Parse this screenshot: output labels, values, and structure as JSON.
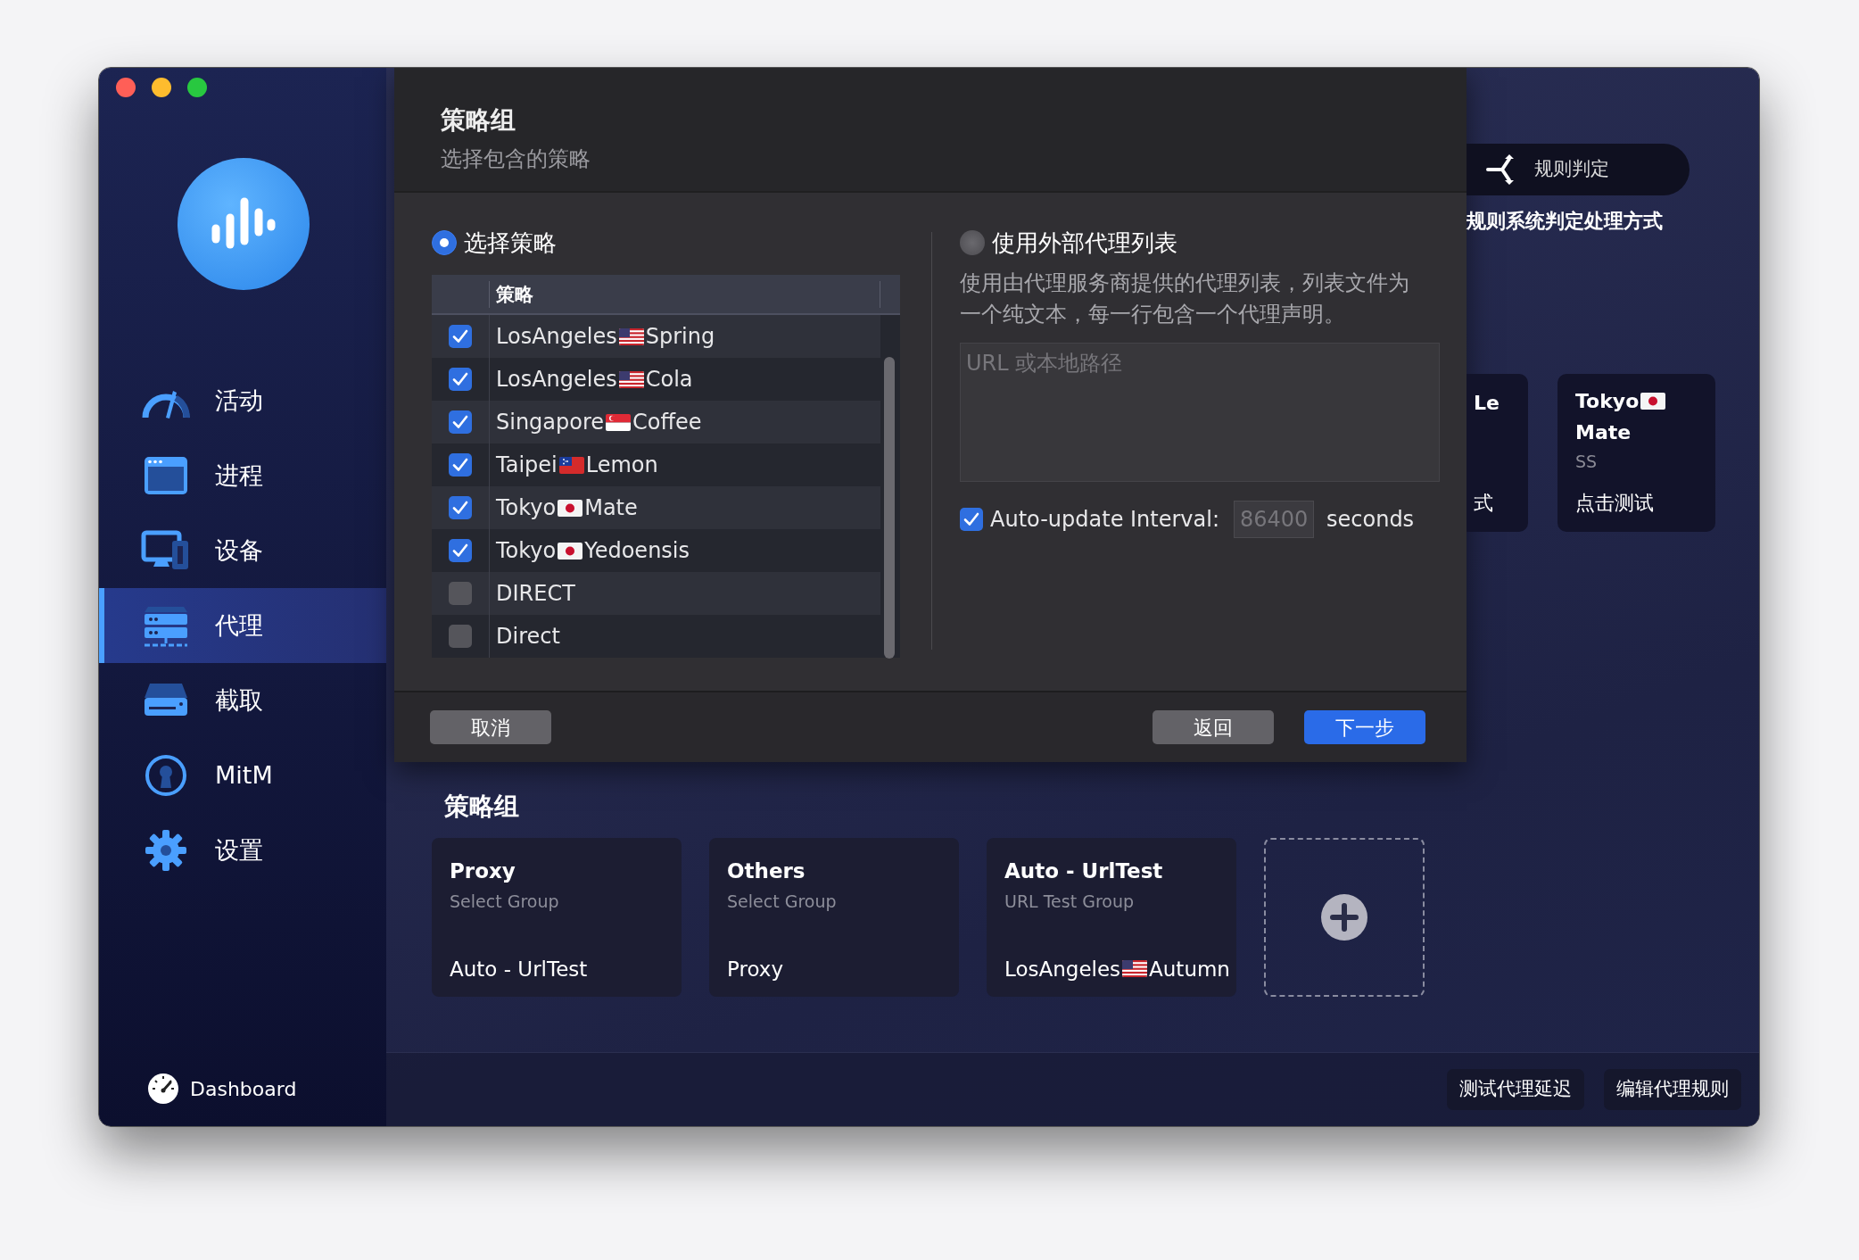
{
  "sidebar": {
    "items": [
      {
        "label": "活动",
        "selected": false
      },
      {
        "label": "进程",
        "selected": false
      },
      {
        "label": "设备",
        "selected": false
      },
      {
        "label": "代理",
        "selected": true
      },
      {
        "label": "截取",
        "selected": false
      },
      {
        "label": "MitM",
        "selected": false
      },
      {
        "label": "设置",
        "selected": false
      }
    ],
    "footer": "Dashboard"
  },
  "sheet": {
    "title": "策略组",
    "subtitle": "选择包含的策略",
    "options": [
      {
        "label": "选择策略",
        "selected": true
      },
      {
        "label": "使用外部代理列表",
        "selected": false
      }
    ],
    "policy_table": {
      "column": "策略",
      "rows": [
        {
          "city": "LosAngeles",
          "kind": "us",
          "name": "Spring",
          "checked": true
        },
        {
          "city": "LosAngeles",
          "kind": "us",
          "name": "Cola",
          "checked": true
        },
        {
          "city": "Singapore",
          "kind": "sg",
          "name": "Coffee",
          "checked": true
        },
        {
          "city": "Taipei",
          "kind": "ws",
          "name": "Lemon",
          "checked": true
        },
        {
          "city": "Tokyo",
          "kind": "jp",
          "name": "Mate",
          "checked": true
        },
        {
          "city": "Tokyo",
          "kind": "jp",
          "name": "Yedoensis",
          "checked": true
        },
        {
          "name": "DIRECT",
          "checked": false
        },
        {
          "name": "Direct",
          "checked": false
        }
      ]
    },
    "external": {
      "description": "使用由代理服务商提供的代理列表，列表文件为一个纯文本，每一行包含一个代理声明。",
      "url_field": {
        "placeholder": "URL 或本地路径"
      },
      "auto_update": {
        "label": "Auto-update Interval:",
        "checked": true,
        "value": "86400",
        "disabled": true,
        "unit": "seconds"
      }
    },
    "buttons": [
      {
        "label": "取消",
        "kind": "plain"
      },
      {
        "label": "返回",
        "kind": "plain"
      },
      {
        "label": "下一步",
        "kind": "primary"
      }
    ]
  },
  "rule_mode": {
    "label": "规则判定",
    "description": "规则系统判定处理方式"
  },
  "proxy_cards": [
    {
      "name": "Le",
      "action": "式"
    },
    {
      "city": "Tokyo",
      "kind": "jp",
      "name": "Mate",
      "type": "SS",
      "action": "点击测试"
    }
  ],
  "groups_title": "策略组",
  "groups": [
    {
      "name": "Proxy",
      "type": "Select Group",
      "current": {
        "name": "Auto - UrlTest"
      }
    },
    {
      "name": "Others",
      "type": "Select Group",
      "current": {
        "name": "Proxy"
      }
    },
    {
      "name": "Auto - UrlTest",
      "type": "URL Test Group",
      "current": {
        "city": "LosAngeles",
        "kind": "us",
        "name": "Autumn"
      }
    }
  ],
  "footer_buttons": [
    {
      "label": "测试代理延迟"
    },
    {
      "label": "编辑代理规则"
    }
  ]
}
